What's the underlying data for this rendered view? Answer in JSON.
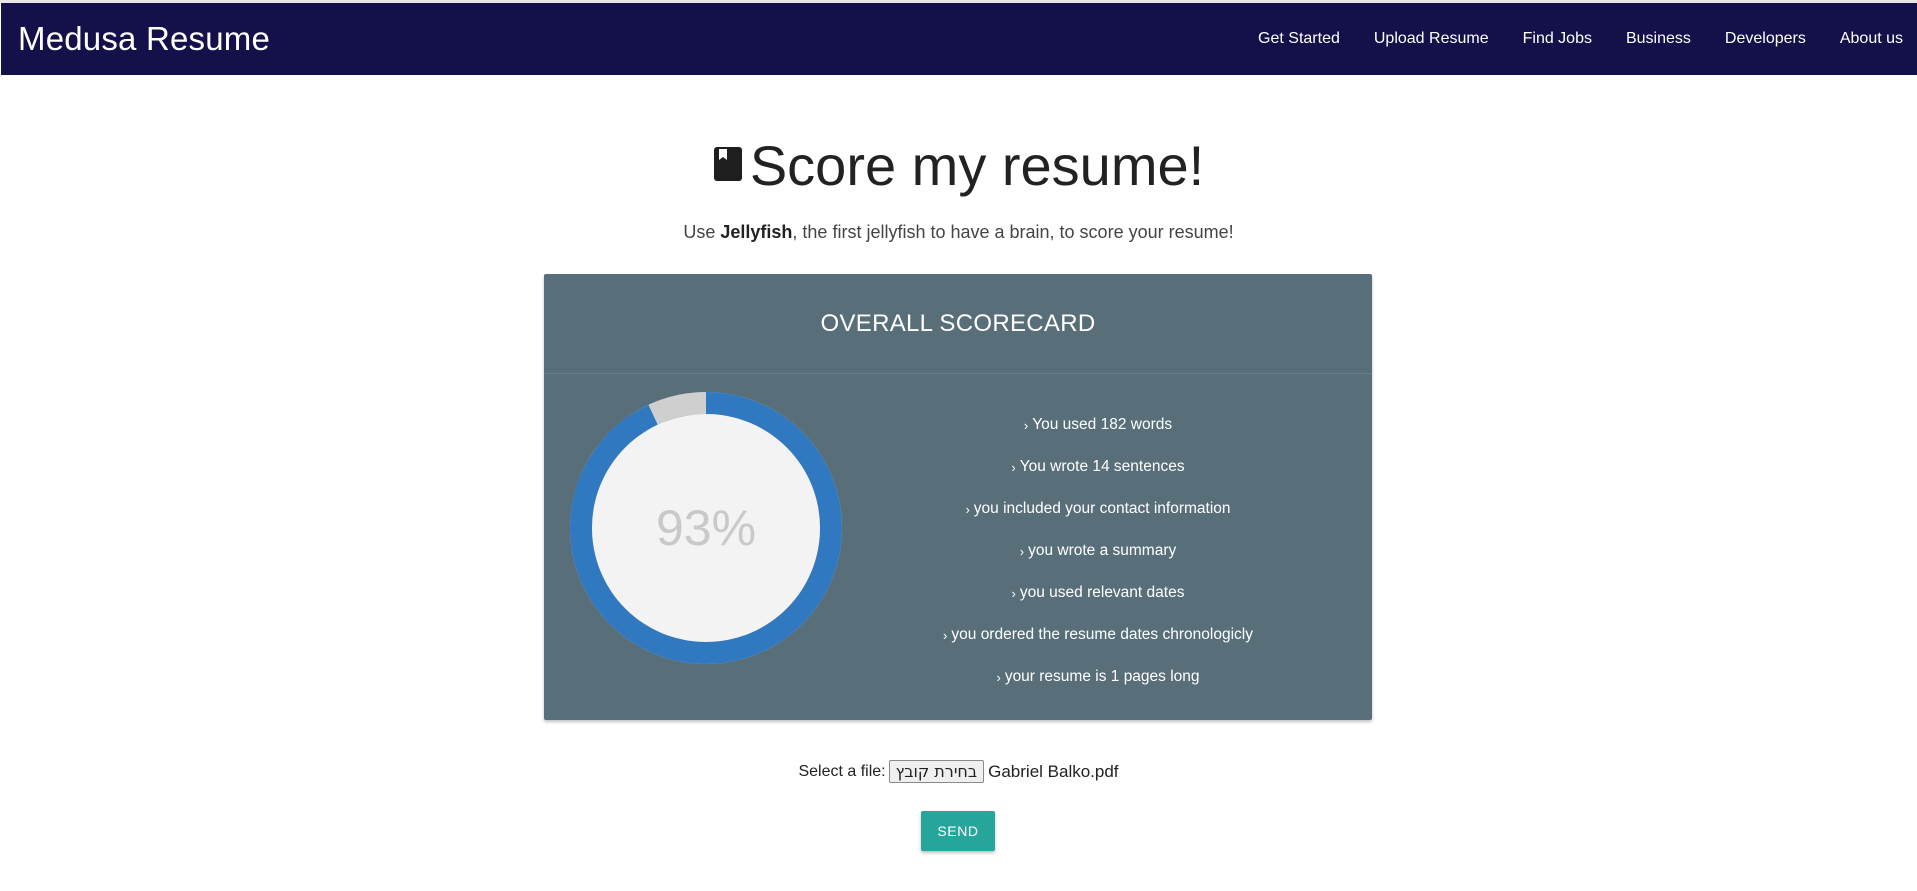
{
  "navbar": {
    "brand": "Medusa Resume",
    "links": [
      {
        "label": "Get Started"
      },
      {
        "label": "Upload Resume"
      },
      {
        "label": "Find Jobs"
      },
      {
        "label": "Business"
      },
      {
        "label": "Developers"
      },
      {
        "label": "About us"
      }
    ]
  },
  "header": {
    "icon": "book-icon",
    "title": "Score my resume!",
    "subtitle_prefix": "Use ",
    "subtitle_bold": "Jellyfish",
    "subtitle_suffix": ", the first jellyfish to have a brain, to score your resume!"
  },
  "scorecard": {
    "title": "OVERALL SCORECARD",
    "score_label": "93%",
    "score_fraction": 0.93,
    "colors": {
      "fill": "#3079c1",
      "remainder": "#cfcfcf",
      "inner": "#f3f3f3",
      "card": "#586f7a"
    },
    "items": [
      {
        "text": "You used 182 words"
      },
      {
        "text": "You wrote 14 sentences"
      },
      {
        "text": "you included your contact information"
      },
      {
        "text": "you wrote a summary"
      },
      {
        "text": "you used relevant dates"
      },
      {
        "text": "you ordered the resume dates chronologicly"
      },
      {
        "text": "your resume is 1 pages long"
      }
    ]
  },
  "upload": {
    "label": "Select a file:",
    "button_label": "בחירת קובץ",
    "file_name": "Gabriel Balko.pdf",
    "send_label": "SEND",
    "send_color": "#26a69a"
  }
}
